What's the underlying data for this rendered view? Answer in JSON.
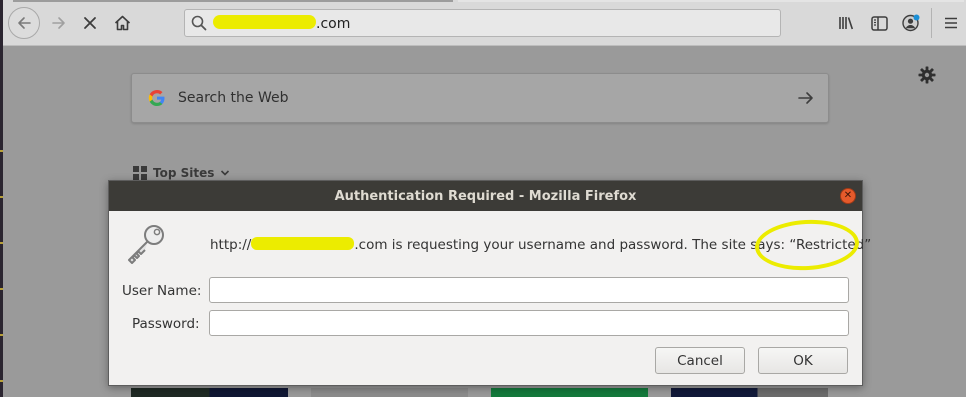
{
  "browser": {
    "url_suffix": ".com",
    "icons": [
      "back-icon",
      "forward-icon",
      "stop-icon",
      "home-icon",
      "search-icon",
      "library-icon",
      "sidebar-icon",
      "account-icon",
      "hamburger-menu-icon"
    ]
  },
  "newtab": {
    "search_placeholder": "Search the Web",
    "top_sites_label": "Top Sites"
  },
  "dialog": {
    "title": "Authentication Required - Mozilla Firefox",
    "message_prefix": "http://",
    "message_suffix": ".com is requesting your username and password. The site says: “Restricted”",
    "username_label": "User Name:",
    "password_label": "Password:",
    "username_value": "",
    "password_value": "",
    "cancel_label": "Cancel",
    "ok_label": "OK"
  },
  "colors": {
    "redaction_highlight": "#ecec00",
    "dialog_titlebar": "#3c3b37",
    "close_button": "#e55a2b"
  }
}
